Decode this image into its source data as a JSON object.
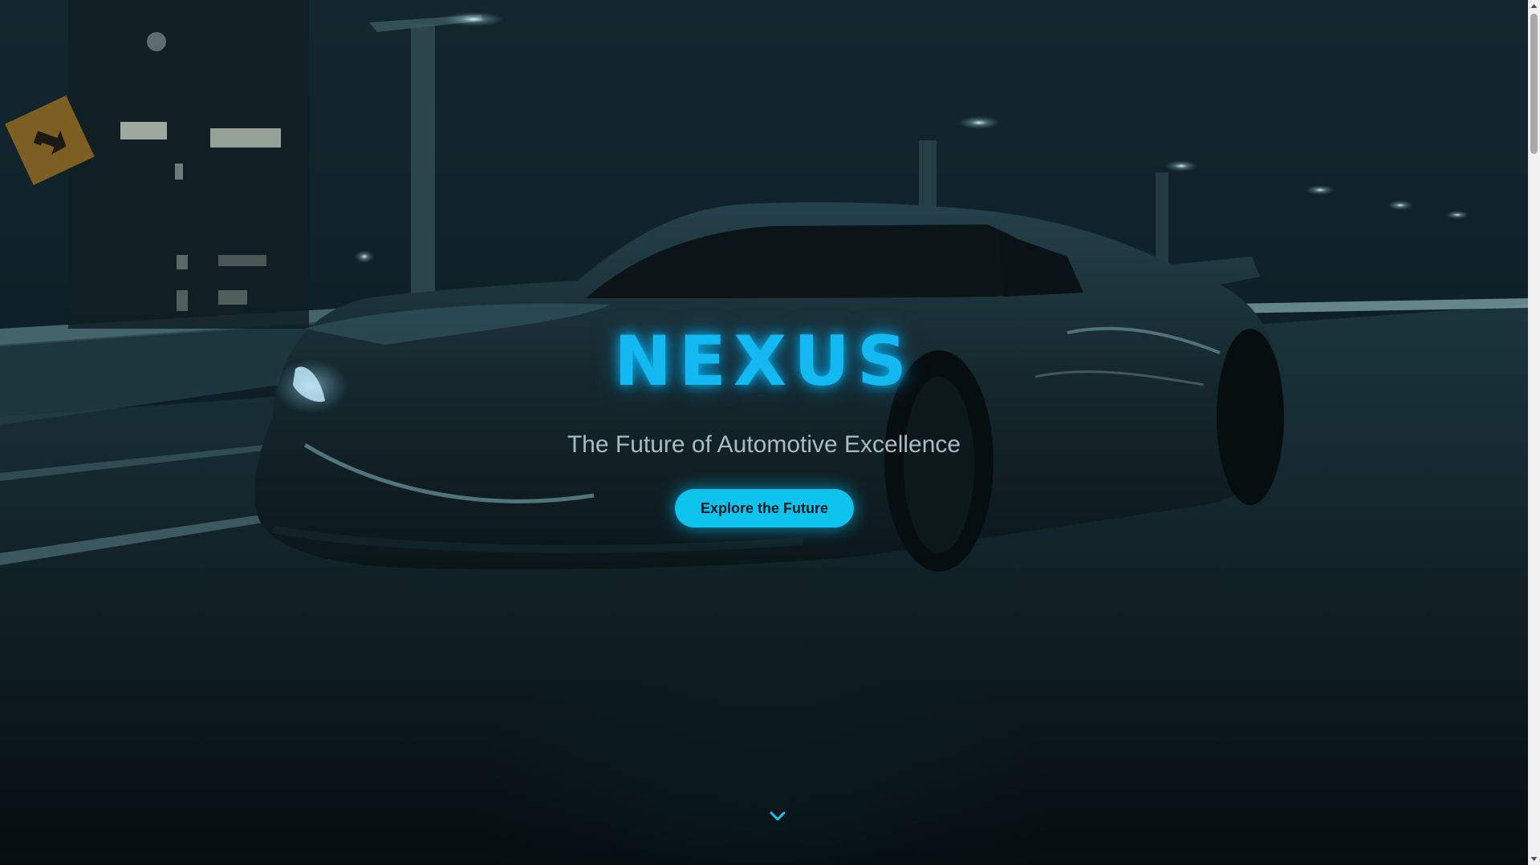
{
  "hero": {
    "title": "NEXUS",
    "subtitle": "The Future of Automotive Excellence",
    "cta_label": "Explore the Future",
    "scroll_icon": "chevron-down-icon"
  },
  "colors": {
    "accent": "#15b9f2",
    "button": "#0fc4ec",
    "background": "#0c1c22"
  },
  "scrollbar": {
    "up_icon": "arrow-up-icon",
    "down_icon": "arrow-down-icon"
  }
}
